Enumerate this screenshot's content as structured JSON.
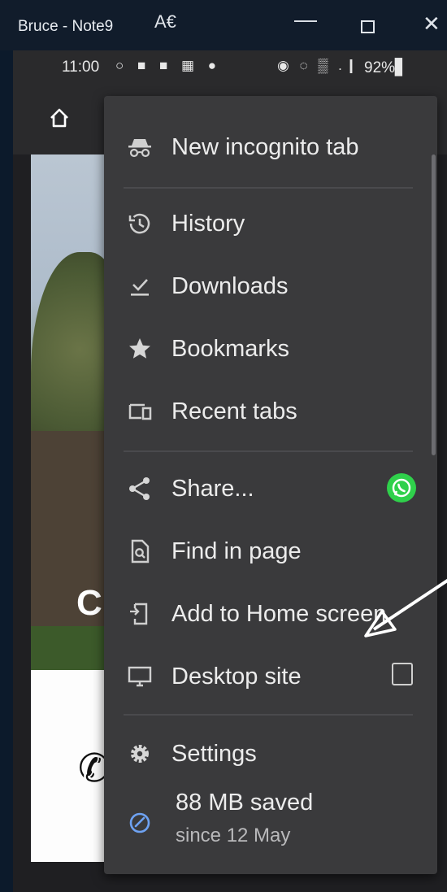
{
  "window": {
    "title": "Bruce - Note9",
    "icons": [
      "text-size-icon",
      "minimize-icon",
      "maximize-icon",
      "close-icon"
    ]
  },
  "statusbar": {
    "time": "11:00",
    "notification_icons": "○ ■ ■ ▦ ●",
    "right_icons": "◉ ◌ ▒ .❙",
    "battery": "92%▋"
  },
  "page": {
    "heading_letter": "C"
  },
  "menu": {
    "items": [
      {
        "label": "New incognito tab",
        "icon": "incognito-icon"
      },
      {
        "label": "History",
        "icon": "history-icon"
      },
      {
        "label": "Downloads",
        "icon": "download-icon"
      },
      {
        "label": "Bookmarks",
        "icon": "star-icon"
      },
      {
        "label": "Recent tabs",
        "icon": "devices-icon"
      },
      {
        "label": "Share...",
        "icon": "share-icon",
        "trailing": "whatsapp-icon"
      },
      {
        "label": "Find in page",
        "icon": "find-in-page-icon"
      },
      {
        "label": "Add to Home screen",
        "icon": "add-to-home-icon"
      },
      {
        "label": "Desktop site",
        "icon": "desktop-icon",
        "trailing": "checkbox"
      },
      {
        "label": "Settings",
        "icon": "gear-icon"
      }
    ],
    "data_saver": {
      "amount": "88 MB saved",
      "since": "since 12 May",
      "icon": "data-saver-gauge-icon"
    }
  },
  "colors": {
    "menu_bg": "#3a3a3c",
    "menu_text": "#ececec",
    "accent_blue": "#6ea2f2",
    "whatsapp_green": "#2fd04b",
    "titlebar_bg": "#111c2b"
  }
}
